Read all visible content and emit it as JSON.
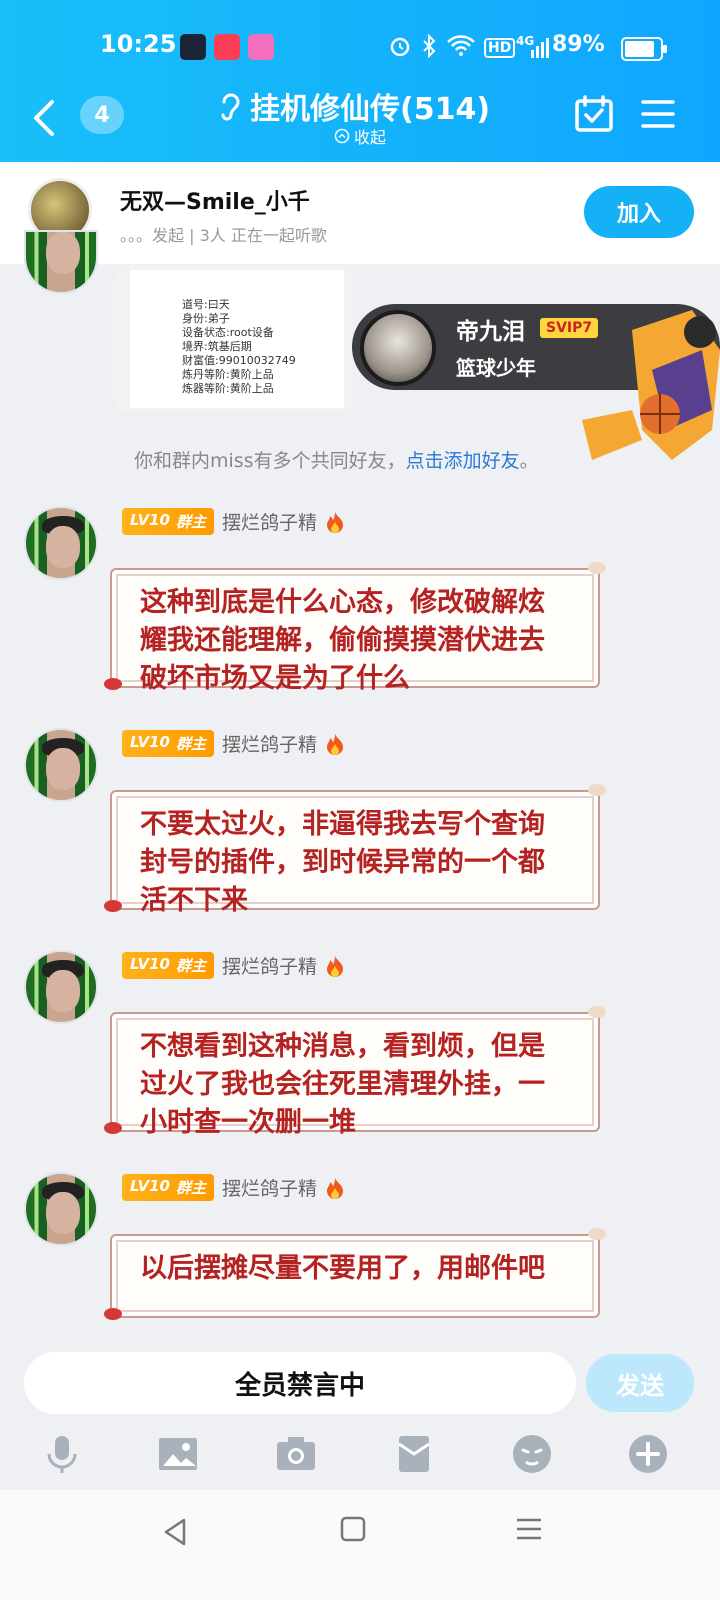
{
  "status_bar": {
    "time": "10:25",
    "network": "4G",
    "battery": "89%",
    "hd_label": "HD"
  },
  "header": {
    "unread_badge": "4",
    "group_title": "挂机修仙传(514)",
    "collapse_label": "收起"
  },
  "music_bar": {
    "user": "无双—Smile_小千",
    "status": "。。。发起 | 3人 正在一起听歌",
    "join_label": "加入"
  },
  "image_message": {
    "lines": [
      "道号:曰天",
      "身份:弟子",
      "设备状态:root设备",
      "境界:筑基后期",
      "财富值:99010032749",
      "炼丹等阶:黄阶上品",
      "炼器等阶:黄阶上品"
    ]
  },
  "profile_card": {
    "name": "帝九泪",
    "vip": "SVIP7",
    "title": "篮球少年"
  },
  "friend_tip": {
    "text": "你和群内miss有多个共同好友，",
    "link": "点击添加好友",
    "end": "。"
  },
  "messages": [
    {
      "level": "LV10",
      "role": "群主",
      "sender": "摆烂鸽子精",
      "text": "这种到底是什么心态，修改破解炫耀我还能理解，偷偷摸摸潜伏进去破坏市场又是为了什么"
    },
    {
      "level": "LV10",
      "role": "群主",
      "sender": "摆烂鸽子精",
      "text": "不要太过火，非逼得我去写个查询封号的插件，到时候异常的一个都活不下来"
    },
    {
      "level": "LV10",
      "role": "群主",
      "sender": "摆烂鸽子精",
      "text": "不想看到这种消息，看到烦，但是过火了我也会往死里清理外挂，一小时查一次删一堆"
    },
    {
      "level": "LV10",
      "role": "群主",
      "sender": "摆烂鸽子精",
      "text": "以后摆摊尽量不要用了，用邮件吧"
    }
  ],
  "input_bar": {
    "placeholder": "全员禁言中",
    "send_label": "发送"
  },
  "toolbar": [
    "mic-icon",
    "image-icon",
    "camera-icon",
    "red-packet-icon",
    "emoji-icon",
    "plus-icon"
  ],
  "colors": {
    "header_blue": "#14b3fb",
    "bubble_text": "#b52222",
    "level_tag": "#ffa40a"
  }
}
